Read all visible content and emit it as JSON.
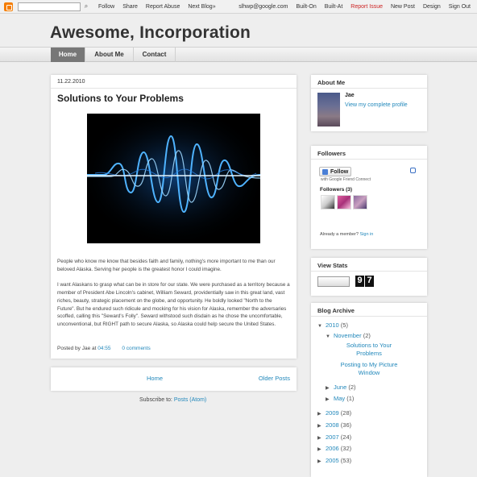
{
  "navbar": {
    "search_placeholder": "",
    "left_links": [
      "Follow",
      "Share",
      "Report Abuse",
      "Next Blog»"
    ],
    "right_links": [
      "slhwp@google.com",
      "Built-On",
      "Built-At",
      "Report Issue",
      "New Post",
      "Design",
      "Sign Out"
    ]
  },
  "header": {
    "title": "Awesome, Incorporation",
    "tabs": [
      "Home",
      "About Me",
      "Contact"
    ]
  },
  "post": {
    "date": "11.22.2010",
    "title": "Solutions to Your Problems",
    "paragraphs": [
      "People who know me know that besides faith and family, nothing's more important to me than our beloved Alaska. Serving her people is the greatest honor I could imagine.",
      "I want Alaskans to grasp what can be in store for our state. We were purchased as a territory because a member of President Abe Lincoln's cabinet, William Seward, providentially saw in this great land, vast riches, beauty, strategic placement on the globe, and opportunity. He boldly looked \"North to the Future\". But he endured such ridicule and mocking for his vision for Alaska, remember the adversaries scoffed, calling this \"Seward's Folly\". Seward withstood such disdain as he chose the uncomfortable, unconventional, but RIGHT path to secure Alaska, so Alaska could help secure the United States."
    ],
    "footer_prefix": "Posted by Jae at",
    "time": "04:55",
    "comments": "0 comments"
  },
  "pager": {
    "home": "Home",
    "older": "Older Posts"
  },
  "subscribe": {
    "prefix": "Subscribe to:",
    "link": "Posts (Atom)"
  },
  "sidebar": {
    "about": {
      "title": "About Me",
      "name": "Jae",
      "profile_link": "View my complete profile"
    },
    "followers": {
      "title": "Followers",
      "follow_label": "Follow",
      "gfc_text": "with Google Friend Connect",
      "count_label": "Followers (3)",
      "already_text": "Already a member?",
      "sign_in": "Sign in"
    },
    "stats": {
      "title": "View Stats",
      "digits": [
        "9",
        "7"
      ]
    },
    "archive": {
      "title": "Blog Archive",
      "years_open": {
        "label": "2010",
        "count": "(5)"
      },
      "month_open": {
        "label": "November",
        "count": "(2)"
      },
      "posts": [
        "Solutions to Your Problems",
        "Posting to My Picture Window"
      ],
      "months": [
        {
          "label": "June",
          "count": "(2)"
        },
        {
          "label": "May",
          "count": "(1)"
        }
      ],
      "years": [
        {
          "label": "2009",
          "count": "(28)"
        },
        {
          "label": "2008",
          "count": "(36)"
        },
        {
          "label": "2007",
          "count": "(24)"
        },
        {
          "label": "2006",
          "count": "(32)"
        },
        {
          "label": "2005",
          "count": "(53)"
        }
      ]
    }
  },
  "colors": {
    "link": "#2288bb",
    "report": "#cc2222",
    "active_tab": "#777777"
  }
}
